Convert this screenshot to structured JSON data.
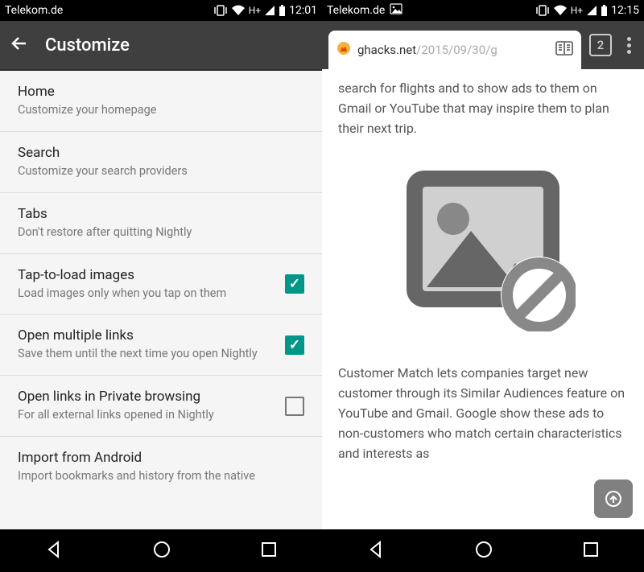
{
  "left": {
    "status": {
      "carrier": "Telekom.de",
      "net": "H+",
      "time": "12:01"
    },
    "title": "Customize",
    "items": [
      {
        "title": "Home",
        "sub": "Customize your homepage"
      },
      {
        "title": "Search",
        "sub": "Customize your search providers"
      },
      {
        "title": "Tabs",
        "sub": "Don't restore after quitting Nightly"
      },
      {
        "title": "Tap-to-load images",
        "sub": "Load images only when you tap on them",
        "checked": true
      },
      {
        "title": "Open multiple links",
        "sub": "Save them until the next time you open Nightly",
        "checked": true
      },
      {
        "title": "Open links in Private browsing",
        "sub": "For all external links opened in Nightly",
        "checked": false
      },
      {
        "title": "Import from Android",
        "sub": "Import bookmarks and history from the native"
      }
    ]
  },
  "right": {
    "status": {
      "carrier": "Telekom.de",
      "net": "H+",
      "time": "12:15"
    },
    "url_host": "ghacks.net",
    "url_path": "/2015/09/30/g",
    "tab_count": "2",
    "para1": "search for flights and to show ads to them on Gmail or YouTube that may inspire them to plan their next trip.",
    "para2": "Customer Match lets companies target new customer through its Similar Audiences feature on YouTube and Gmail. Google show these ads to non-customers who match certain characteristics and interests as"
  }
}
